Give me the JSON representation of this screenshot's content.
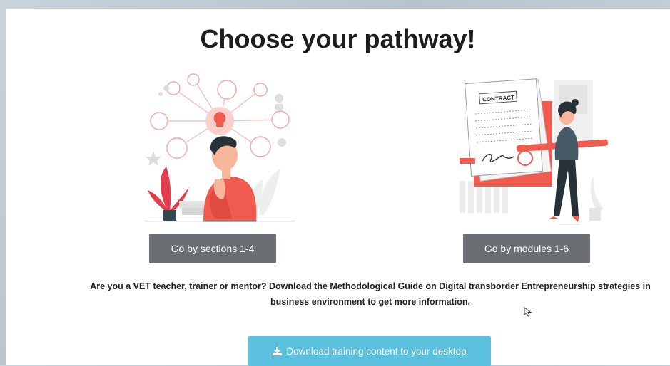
{
  "page": {
    "title": "Choose your pathway!"
  },
  "pathways": {
    "sections_button": "Go by sections 1-4",
    "modules_button": "Go by modules 1-6"
  },
  "illustrations": {
    "contract_label": "CONTRACT",
    "left_icon": "thinking-person-illustration",
    "right_icon": "contract-signing-illustration"
  },
  "info": {
    "text": "Are you a VET teacher, trainer or mentor? Download the Methodological Guide on Digital transborder Entrepreneurship strategies in business environment to get more information."
  },
  "download": {
    "label": "Download training content to your desktop",
    "icon": "download-icon"
  },
  "colors": {
    "button_gray": "#6b6f73",
    "download_blue": "#5bc0de",
    "accent_red": "#f05a4f"
  }
}
